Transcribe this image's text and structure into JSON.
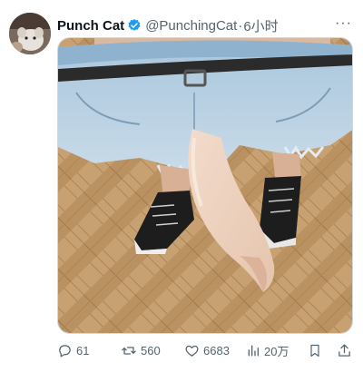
{
  "tweet": {
    "display_name": "Punch Cat",
    "handle": "@PunchingCat",
    "separator": "·",
    "time": "6小时",
    "more_label": "···"
  },
  "actions": {
    "replies": "61",
    "retweets": "560",
    "likes": "6683",
    "views": "20万"
  },
  "icons": [
    "verified-badge-icon",
    "more-icon",
    "reply-icon",
    "retweet-icon",
    "like-icon",
    "views-icon",
    "bookmark-icon",
    "share-icon"
  ],
  "colors": {
    "verified_blue": "#1d9bf0",
    "muted": "#536471",
    "text": "#0f1419"
  }
}
